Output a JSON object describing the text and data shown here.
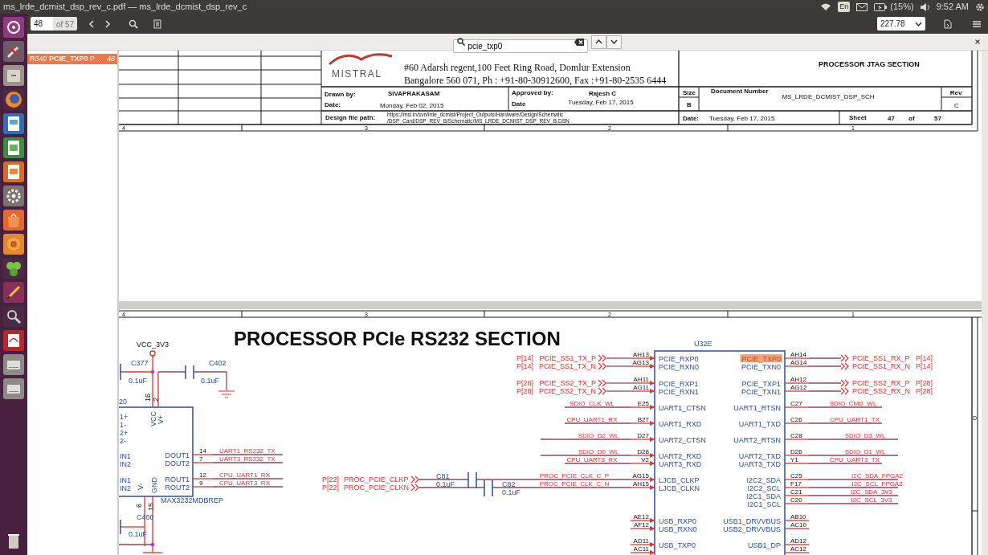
{
  "window": {
    "title": "ms_lrde_dcmist_dsp_rev_c.pdf — ms_lrde_dcmist_dsp_rev_c"
  },
  "top_panel": {
    "keyboard": "En",
    "battery": "(15%)",
    "time": "9:52 AM"
  },
  "toolbar": {
    "page": "48",
    "page_count": "of 57",
    "zoom": "227.78"
  },
  "find": {
    "query": "pcie_txp0"
  },
  "results": [
    {
      "ref": "R349",
      "match": "PCIE_TXP0",
      "rest": "P…",
      "page": "48",
      "selected": true
    }
  ],
  "sheet_1": {
    "ruler": [
      "4",
      "3",
      "2",
      "1"
    ],
    "logo": "MISTRAL",
    "address": [
      "#60 Adarsh regent,100 Feet Ring Road, Domlur Extension",
      "Bangalore 560 071, Ph : +91-80-30912600, Fax :+91-80-2535 6444"
    ],
    "title": "PROCESSOR JTAG SECTION",
    "drawn_by_label": "Drawn by:",
    "drawn_by": "SIVAPRAKASAM",
    "date_label": "Date:",
    "date": "Monday, Feb 02, 2015",
    "approved_by_label": "Approved by:",
    "approved_by": "Rajesh C",
    "approved_date_label": "Date",
    "approved_date": "Tuesday, Feb 17, 2015",
    "size_label": "Size",
    "size": "B",
    "doc_number_label": "Document Number",
    "doc_number": "MS_LRDE_DCMIST_DSP_SCH",
    "rev_label": "Rev",
    "rev": "C",
    "path_label": "Design file path:",
    "path": [
      "https://msl.in/svn/lrde_dcmist/Project_Outputs/Hardware/Design/Schematic",
      "/DSP_Card/DSP_REV_B/Schematic/MS_LRDE_DCMIST_DSP_REV_B.DSN"
    ],
    "sheet_date_label": "Date:",
    "sheet_date": "Tuesday, Feb 17, 2015",
    "sheet_label": "Sheet",
    "sheet": "47",
    "of_label": "of",
    "sheet_total": "57"
  },
  "sheet_2": {
    "ruler": [
      "4",
      "3",
      "2",
      "1"
    ],
    "zone": "D",
    "title": "PROCESSOR PCIe RS232 SECTION",
    "power_net": "VCC_3V3",
    "capacitors": [
      {
        "ref": "C377",
        "value": "0.1uF"
      },
      {
        "ref": "C402",
        "value": "0.1uF"
      },
      {
        "ref": "C400",
        "value": "0.1uF"
      },
      {
        "ref": "C81",
        "value": "0.1uF"
      },
      {
        "ref": "C82",
        "value": "0.1uF"
      }
    ],
    "rs232": {
      "ref": "20",
      "part": "MAX3232MDBREP",
      "left_pins": [
        "1+",
        "1-",
        "2+",
        "2-",
        "IN1",
        "IN2",
        "IN1",
        "IN2"
      ],
      "supply_pins": [
        {
          "number": "16",
          "name": "VCC"
        },
        {
          "number": "2",
          "name": "V+"
        },
        {
          "number": "6",
          "name": "V-"
        },
        {
          "number": "15",
          "name": "GND"
        }
      ],
      "outputs": [
        {
          "name": "DOUT1",
          "number": "14",
          "net": "UART1_RS232_TX"
        },
        {
          "name": "DOUT2",
          "number": "7",
          "net": "UART3_RS232_TX"
        },
        {
          "name": "ROUT1",
          "number": "12",
          "net": "CPU_UART1_RX"
        },
        {
          "name": "ROUT2",
          "number": "9",
          "net": "CPU_UART3_RX"
        }
      ]
    },
    "clock_inputs": [
      {
        "page": "P[22]",
        "net": "PROC_PCIE_CLKP"
      },
      {
        "page": "P[22]",
        "net": "PROC_PCIE_CLKN"
      }
    ],
    "processor": {
      "ref": "U32E",
      "left": [
        {
          "pin": "AH13",
          "name": "PCIE_RXP0",
          "kind": "offpage",
          "net": "PCIE_SS1_TX_P",
          "page": "P[14]"
        },
        {
          "pin": "AG13",
          "name": "PCIE_RXN0",
          "kind": "offpage",
          "net": "PCIE_SS1_TX_N",
          "page": "P[14]"
        },
        {
          "pin": "AH11",
          "name": "PCIE_RXP1",
          "kind": "offpage",
          "net": "PCIE_SS2_TX_P",
          "page": "P[28]"
        },
        {
          "pin": "AG11",
          "name": "PCIE_RXN1",
          "kind": "offpage",
          "net": "PCIE_SS2_TX_N",
          "page": "P[28]"
        },
        {
          "pin": "E25",
          "name": "UART1_CTSN",
          "kind": "net",
          "net": "SDIO_CLK_WL"
        },
        {
          "pin": "B27",
          "name": "UART1_RXD",
          "kind": "net",
          "net": "CPU_UART1_RX"
        },
        {
          "pin": "D27",
          "name": "UART2_CTSN",
          "kind": "net",
          "net": "SDIO_D2_WL"
        },
        {
          "pin": "D28",
          "name": "UART2_RXD",
          "kind": "net",
          "net": "SDIO_D0_WL"
        },
        {
          "pin": "V2",
          "name": "UART3_RXD",
          "kind": "net",
          "net": "CPU_UART3_RX"
        },
        {
          "pin": "AG15",
          "name": "LJCB_CLKP",
          "kind": "net",
          "net": "PROC_PCIE_CLK_C_P"
        },
        {
          "pin": "AH15",
          "name": "LJCB_CLKN",
          "kind": "net",
          "net": "PROC_PCIE_CLK_C_N"
        },
        {
          "pin": "AE12",
          "name": "USB_RXP0",
          "kind": "open"
        },
        {
          "pin": "AF12",
          "name": "USB_RXN0",
          "kind": "open"
        },
        {
          "pin": "AD11",
          "name": "USB_TXP0",
          "kind": "open"
        },
        {
          "pin": "AC11",
          "kind": "open"
        }
      ],
      "right": [
        {
          "pin": "AH14",
          "name": "PCIE_TXP0",
          "kind": "offpage",
          "net": "PCIE_SS1_RX_P",
          "page": "P[14]",
          "highlighted": true
        },
        {
          "pin": "AG14",
          "name": "PCIE_TXN0",
          "kind": "offpage",
          "net": "PCIE_SS1_RX_N",
          "page": "P[14]",
          "highlighted": false
        },
        {
          "pin": "AH12",
          "name": "PCIE_TXP1",
          "kind": "offpage",
          "net": "PCIE_SS2_RX_P",
          "page": "P[28]",
          "highlighted": false
        },
        {
          "pin": "AG12",
          "name": "PCIE_TXN1",
          "kind": "offpage",
          "net": "PCIE_SS2_RX_N",
          "page": "P[28]",
          "highlighted": false
        },
        {
          "pin": "C27",
          "name": "UART1_RTSN",
          "kind": "net",
          "net": "SDIO_CMD_WL",
          "highlighted": false
        },
        {
          "pin": "C26",
          "name": "UART1_TXD",
          "kind": "net",
          "net": "CPU_UART1_TX",
          "highlighted": false
        },
        {
          "pin": "C28",
          "name": "UART2_RTSN",
          "kind": "net",
          "net": "SDIO_D3_WL",
          "highlighted": false
        },
        {
          "pin": "D26",
          "name": "UART2_TXD",
          "kind": "net",
          "net": "SDIO_D1_WL",
          "highlighted": false
        },
        {
          "pin": "Y1",
          "name": "UART3_TXD",
          "kind": "net",
          "net": "CPU_UART3_TX",
          "highlighted": false
        },
        {
          "pin": "C25",
          "name": "I2C2_SDA",
          "kind": "net",
          "net": "I2C_SDA_FPGA2",
          "highlighted": false
        },
        {
          "pin": "F17",
          "name": "I2C2_SCL",
          "kind": "net",
          "net": "I2C_SCL_FPGA2",
          "highlighted": false
        },
        {
          "pin": "C21",
          "name": "I2C1_SDA",
          "kind": "net",
          "net": "I2C_SDA_3V3",
          "highlighted": false
        },
        {
          "pin": "C20",
          "name": "I2C1_SCL",
          "kind": "net",
          "net": "I2C_SCL_3V3",
          "highlighted": false
        },
        {
          "pin": "AB10",
          "name": "USB1_DRVVBUS",
          "kind": "open",
          "highlighted": false
        },
        {
          "pin": "AC10",
          "name": "USB2_DRVVBUS",
          "kind": "open",
          "highlighted": false
        },
        {
          "pin": "AD12",
          "name": "USB1_DP",
          "kind": "open",
          "highlighted": false
        },
        {
          "pin": "AC12",
          "kind": "open"
        }
      ]
    }
  }
}
